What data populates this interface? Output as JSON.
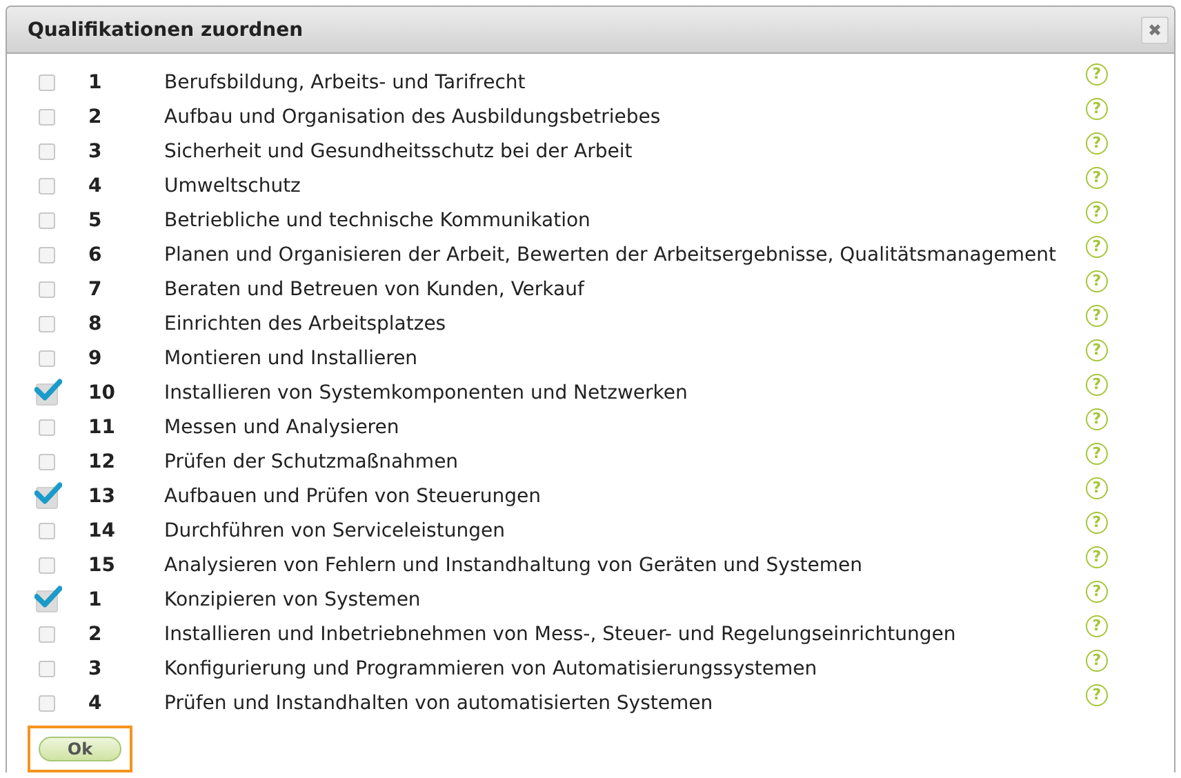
{
  "dialog": {
    "title": "Qualifikationen zuordnen",
    "close": "✖"
  },
  "rows": [
    {
      "number": "1",
      "label": "Berufsbildung, Arbeits- und Tarifrecht",
      "checked": false,
      "help": "?"
    },
    {
      "number": "2",
      "label": "Aufbau und Organisation des Ausbildungsbetriebes",
      "checked": false,
      "help": "?"
    },
    {
      "number": "3",
      "label": "Sicherheit und Gesundheitsschutz bei der Arbeit",
      "checked": false,
      "help": "?"
    },
    {
      "number": "4",
      "label": "Umweltschutz",
      "checked": false,
      "help": "?"
    },
    {
      "number": "5",
      "label": "Betriebliche und technische Kommunikation",
      "checked": false,
      "help": "?"
    },
    {
      "number": "6",
      "label": "Planen und Organisieren der Arbeit, Bewerten der Arbeitsergebnisse, Qualitätsmanagement",
      "checked": false,
      "help": "?"
    },
    {
      "number": "7",
      "label": "Beraten und Betreuen von Kunden, Verkauf",
      "checked": false,
      "help": "?"
    },
    {
      "number": "8",
      "label": "Einrichten des Arbeitsplatzes",
      "checked": false,
      "help": "?"
    },
    {
      "number": "9",
      "label": "Montieren und Installieren",
      "checked": false,
      "help": "?"
    },
    {
      "number": "10",
      "label": "Installieren von Systemkomponenten und Netzwerken",
      "checked": true,
      "help": "?"
    },
    {
      "number": "11",
      "label": "Messen und Analysieren",
      "checked": false,
      "help": "?"
    },
    {
      "number": "12",
      "label": "Prüfen der Schutzmaßnahmen",
      "checked": false,
      "help": "?"
    },
    {
      "number": "13",
      "label": "Aufbauen und Prüfen von Steuerungen",
      "checked": true,
      "help": "?"
    },
    {
      "number": "14",
      "label": "Durchführen von Serviceleistungen",
      "checked": false,
      "help": "?"
    },
    {
      "number": "15",
      "label": "Analysieren von Fehlern und Instandhaltung von Geräten und Systemen",
      "checked": false,
      "help": "?"
    },
    {
      "number": "1",
      "label": "Konzipieren von Systemen",
      "checked": true,
      "help": "?"
    },
    {
      "number": "2",
      "label": "Installieren und Inbetriebnehmen von Mess-, Steuer- und Regelungseinrichtungen",
      "checked": false,
      "help": "?"
    },
    {
      "number": "3",
      "label": "Konfigurierung und Programmieren von Automatisierungssystemen",
      "checked": false,
      "help": "?"
    },
    {
      "number": "4",
      "label": "Prüfen und Instandhalten von automatisierten Systemen",
      "checked": false,
      "help": "?"
    }
  ],
  "ok_button": {
    "label": "Ok",
    "focused": true
  }
}
